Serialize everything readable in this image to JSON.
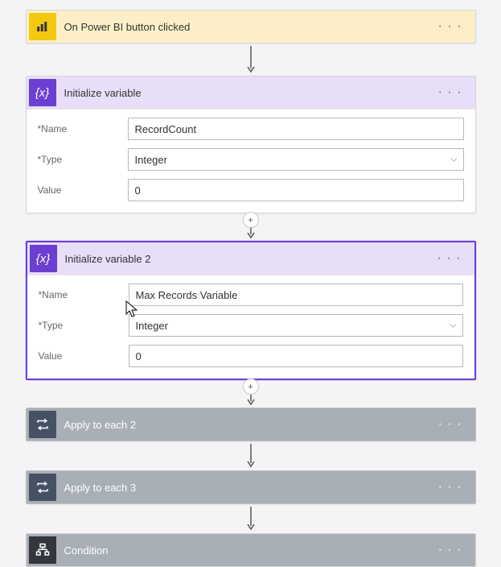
{
  "trigger": {
    "title": "On Power BI button clicked"
  },
  "var1": {
    "title": "Initialize variable",
    "fields": {
      "name_label": "*Name",
      "name_value": "RecordCount",
      "type_label": "*Type",
      "type_value": "Integer",
      "value_label": "Value",
      "value_value": "0"
    }
  },
  "var2": {
    "title": "Initialize variable 2",
    "fields": {
      "name_label": "*Name",
      "name_value": "Max Records Variable",
      "type_label": "*Type",
      "type_value": "Integer",
      "value_label": "Value",
      "value_value": "0"
    }
  },
  "apply2": {
    "title": "Apply to each 2"
  },
  "apply3": {
    "title": "Apply to each 3"
  },
  "condition": {
    "title": "Condition"
  },
  "glyphs": {
    "dots": "· · ·",
    "plus": "+"
  }
}
